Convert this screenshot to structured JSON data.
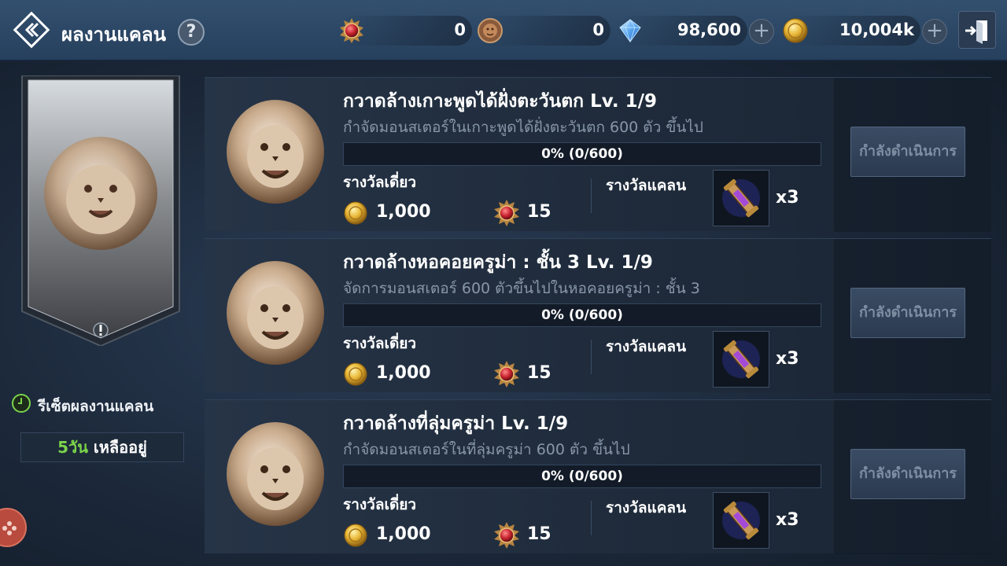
{
  "header": {
    "title": "ผลงานแคลน",
    "help_label": "?",
    "currencies": [
      {
        "icon": "red-medal-icon",
        "value": "0"
      },
      {
        "icon": "lion-coin-icon",
        "value": "0"
      },
      {
        "icon": "blue-diamond-icon",
        "value": "98,600",
        "has_plus": true
      },
      {
        "icon": "gold-coin-icon",
        "value": "10,004k",
        "has_plus": true
      }
    ],
    "plus_label": "+"
  },
  "sidebar": {
    "reset_label": "รีเซ็ตผลงานแคลน",
    "remain_days": "5วัน",
    "remain_suffix": " เหลืออยู่"
  },
  "quests": [
    {
      "title": "กวาดล้างเกาะพูดได้ฝั่งตะวันตก Lv. 1/9",
      "description": "กำจัดมอนสเตอร์ในเกาะพูดได้ฝั่งตะวันตก 600 ตัว ขึ้นไป",
      "progress_text": "0% (0/600)",
      "progress_fraction": 0,
      "single_reward_label": "รางวัลเดี่ยว",
      "coin_reward": "1,000",
      "medal_reward": "15",
      "clan_reward_label": "รางวัลแคลน",
      "clan_item_qty": "x3",
      "status_label": "กำลังดำเนินการ"
    },
    {
      "title": "กวาดล้างหอคอยครูม่า : ชั้น 3 Lv. 1/9",
      "description": "จัดการมอนสเตอร์ 600 ตัวขึ้นไปในหอคอยครูม่า : ชั้น 3",
      "progress_text": "0% (0/600)",
      "progress_fraction": 0,
      "single_reward_label": "รางวัลเดี่ยว",
      "coin_reward": "1,000",
      "medal_reward": "15",
      "clan_reward_label": "รางวัลแคลน",
      "clan_item_qty": "x3",
      "status_label": "กำลังดำเนินการ"
    },
    {
      "title": "กวาดล้างที่ลุ่มครูม่า Lv. 1/9",
      "description": "กำจัดมอนสเตอร์ในที่ลุ่มครูม่า 600 ตัว ขึ้นไป",
      "progress_text": "0% (0/600)",
      "progress_fraction": 0,
      "single_reward_label": "รางวัลเดี่ยว",
      "coin_reward": "1,000",
      "medal_reward": "15",
      "clan_reward_label": "รางวัลแคลน",
      "clan_item_qty": "x3",
      "status_label": "กำลังดำเนินการ"
    }
  ],
  "colors": {
    "remain_days": "#7bd34a",
    "progress_fill": "#4f8fd0",
    "medal_red": "#c8242f",
    "gold": "#e0b23a"
  }
}
